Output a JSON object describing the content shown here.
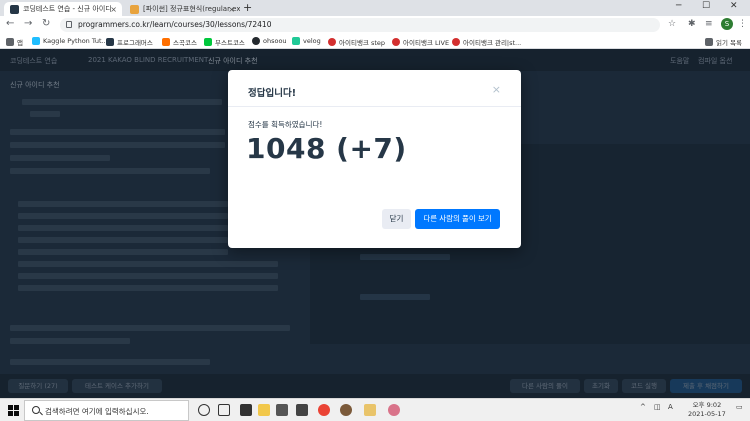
{
  "browser": {
    "tabs": [
      {
        "label": "코딩테스트 연습 - 신규 아이디",
        "favicon_color": "#263747",
        "active": true
      },
      {
        "label": "[파이썬] 정규표현식(regular exp",
        "favicon_color": "#e8a33d",
        "active": false
      }
    ],
    "new_tab_label": "+",
    "window_controls": {
      "minimize": "─",
      "maximize": "☐",
      "close": "✕"
    },
    "nav": {
      "back": "←",
      "forward": "→",
      "reload": "↻"
    },
    "url": "programmers.co.kr/learn/courses/30/lessons/72410",
    "profile_initial": "S",
    "bookmarks": [
      {
        "label": "앱",
        "color": "#5f6368"
      },
      {
        "label": "Kaggle Python Tut...",
        "color": "#20beff"
      },
      {
        "label": "프로그래머스",
        "color": "#263747"
      },
      {
        "label": "스곡코스",
        "color": "#ff6f00"
      },
      {
        "label": "부스트코스",
        "color": "#00c73c"
      },
      {
        "label": "ohsoou",
        "color": "#24292e"
      },
      {
        "label": "velog",
        "color": "#20c997"
      },
      {
        "label": "아이티뱅크 step",
        "color": "#d32f2f"
      },
      {
        "label": "아이티뱅크 LIVE",
        "color": "#d32f2f"
      },
      {
        "label": "아이티뱅크 관리|st...",
        "color": "#d32f2f"
      }
    ],
    "reading_list": "읽기 목록"
  },
  "background": {
    "header": {
      "brand": "코딩테스트 연습",
      "breadcrumb": "2021 KAKAO BLIND RECRUITMENT",
      "problem_title": "신규 아이디 추천",
      "right_links": [
        "도움말",
        "컴파일 옵션"
      ]
    },
    "section_title": "신규 아이디 추천",
    "footer_buttons": [
      "질문하기 (27)",
      "테스트 케이스 추가하기",
      "다른 사람의 풀이",
      "초기화",
      "코드 실행",
      "제출 후 채점하기"
    ]
  },
  "modal": {
    "title": "정답입니다!",
    "close_icon": "×",
    "message": "점수를 획득하였습니다!",
    "score": "1048 (+7)",
    "close_button": "닫기",
    "others_button": "다른 사람의 풀이 보기",
    "accent": "#0078ff"
  },
  "taskbar": {
    "search_placeholder": "검색하려면 여기에 입력하십시오.",
    "tray_label": "^",
    "ime": "A",
    "time": "오후 9:02",
    "date": "2021-05-17"
  }
}
